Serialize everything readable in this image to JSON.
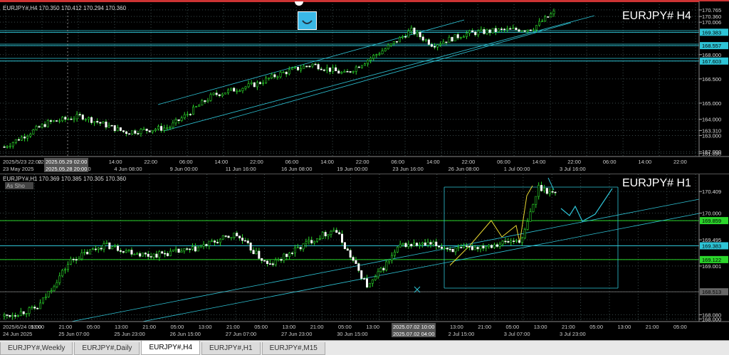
{
  "top": {
    "info": "EURJPY#,H4  170.350 170.412 170.294 170.360",
    "symbol_label": "EURJPY# H4",
    "price_labels": [
      {
        "v": 170.765,
        "t": "170.765"
      },
      {
        "v": 170.36,
        "t": "170.360"
      },
      {
        "v": 170.006,
        "t": "170.006"
      },
      {
        "v": 169.383,
        "t": "169.383",
        "hl": "cyan"
      },
      {
        "v": 168.557,
        "t": "168.557",
        "hl": "cyan"
      },
      {
        "v": 168.0,
        "t": "168.000"
      },
      {
        "v": 167.603,
        "t": "167.603",
        "hl": "cyan"
      },
      {
        "v": 166.5,
        "t": "166.500"
      },
      {
        "v": 165.0,
        "t": "165.000"
      },
      {
        "v": 164.0,
        "t": "164.000"
      },
      {
        "v": 163.31,
        "t": "163.310"
      },
      {
        "v": 163.0,
        "t": "163.000"
      },
      {
        "v": 162.0,
        "t": "162.000"
      },
      {
        "v": 161.89,
        "t": "161.890"
      }
    ],
    "time_labels": [
      "2025/5/23 22:00",
      "22:00",
      "06:00",
      "14:00",
      "22:00",
      "06:00",
      "14:00",
      "22:00",
      "06:00",
      "14:00",
      "22:00",
      "06:00",
      "14:00",
      "22:00",
      "06:00",
      "14:00",
      "22:00",
      "06:00",
      "14:00",
      "22:00"
    ],
    "time_labels2": [
      "23 May 2025",
      "30 May 16:00",
      "4 Jun 08:00",
      "9 Jun 00:00",
      "11 Jun 16:00",
      "16 Jun 08:00",
      "19 Jun 00:00",
      "23 Jun 16:00",
      "26 Jun 08:00",
      "1 Jul 00:00",
      "3 Jul 16:00"
    ],
    "crosshair_label1": "2025.05.29 02:00",
    "crosshair_label2": "2025.05.28 20:00"
  },
  "bottom": {
    "info": "EURJPY#,H1  170.369 170.385 170.305 170.360",
    "as_shot": "As Sho",
    "symbol_label": "EURJPY# H1",
    "price_labels": [
      {
        "v": 170.409,
        "t": "170.409"
      },
      {
        "v": 170.0,
        "t": "170.000"
      },
      {
        "v": 169.859,
        "t": "169.859",
        "hl": "green"
      },
      {
        "v": 169.495,
        "t": "169.495"
      },
      {
        "v": 169.383,
        "t": "169.383",
        "hl": "cyan"
      },
      {
        "v": 169.122,
        "t": "169.122",
        "hl": "green"
      },
      {
        "v": 169.001,
        "t": "169.001"
      },
      {
        "v": 168.513,
        "t": "168.513",
        "hl": "gray"
      },
      {
        "v": 168.08,
        "t": "168.080"
      },
      {
        "v": 168.0,
        "t": "168.000"
      }
    ],
    "time_labels": [
      "2025/6/24 05:00",
      "13:00",
      "21:00",
      "05:00",
      "13:00",
      "21:00",
      "05:00",
      "13:00",
      "21:00",
      "05:00",
      "13:00",
      "21:00",
      "05:00",
      "13:00",
      "21:00",
      "05:00",
      "13:00",
      "21:00",
      "05:00",
      "13:00",
      "21:00",
      "05:00",
      "13:00",
      "21:00",
      "05:00"
    ],
    "time_labels2": [
      "24 Jun 2025",
      "25 Jun 07:00",
      "25 Jun 23:00",
      "26 Jun 15:00",
      "27 Jun 07:00",
      "27 Jun 23:00",
      "30 Jun 15:00",
      "1 Jul 07:00",
      "2 Jul 15:00",
      "3 Jul 07:00",
      "3 Jul 23:00"
    ],
    "crosshair_label1": "2025.07.02 10:00",
    "crosshair_label2": "2025.07.02 04:00"
  },
  "tabs": [
    {
      "label": "EURJPY#,Weekly",
      "active": false
    },
    {
      "label": "EURJPY#,Daily",
      "active": false
    },
    {
      "label": "EURJPY#,H4",
      "active": true
    },
    {
      "label": "EURJPY#,H1",
      "active": false
    },
    {
      "label": "EURJPY#,M15",
      "active": false
    }
  ],
  "colors": {
    "cyan": "#2ec4d6",
    "green": "#2bd62b",
    "yellow": "#e8d830",
    "grid": "#3a4a4a"
  }
}
